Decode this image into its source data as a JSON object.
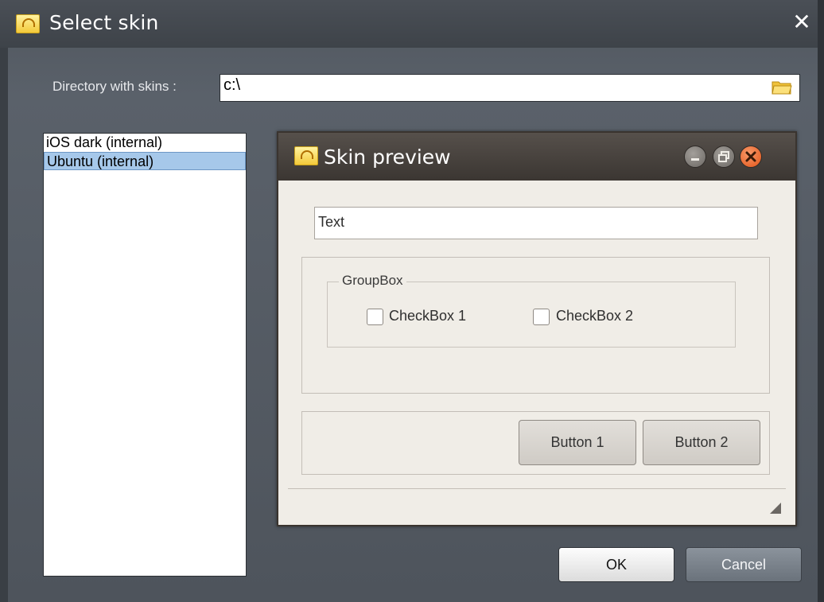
{
  "window": {
    "title": "Select skin",
    "close_glyph": "✕"
  },
  "directory": {
    "label": "Directory with skins :",
    "value": "c:\\"
  },
  "skins": {
    "items": [
      {
        "label": "iOS dark (internal)",
        "selected": false
      },
      {
        "label": "Ubuntu (internal)",
        "selected": true
      }
    ]
  },
  "preview": {
    "title": "Skin preview",
    "text_field_value": "Text",
    "groupbox_label": "GroupBox",
    "checkbox1_label": "CheckBox 1",
    "checkbox2_label": "CheckBox 2",
    "button1_label": "Button 1",
    "button2_label": "Button 2"
  },
  "actions": {
    "ok_label": "OK",
    "cancel_label": "Cancel"
  },
  "colors": {
    "window_bg": "#5a616a",
    "selection": "#a6c8ea",
    "preview_bg": "#f0ede7",
    "close_button": "#e25418"
  },
  "icons": {
    "app": "app-icon",
    "folder": "folder-icon",
    "close": "close-icon"
  }
}
